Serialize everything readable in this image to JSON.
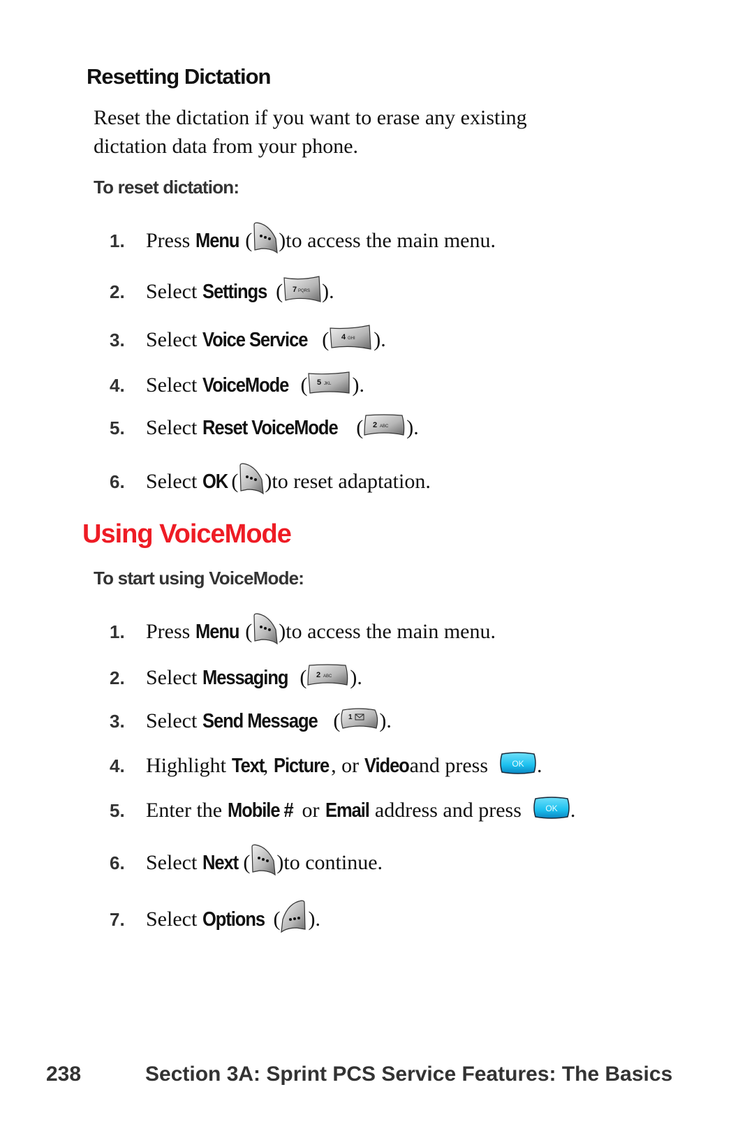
{
  "section1": {
    "heading": "Resetting Dictation",
    "intro_line1": "Reset the dictation if you want to erase any existing",
    "intro_line2": "dictation data from your phone.",
    "subheading": "To reset dictation:",
    "steps": [
      {
        "num": "1.",
        "pre": "Press ",
        "kw": "Menu",
        "icon": "left-softkey-icon",
        "post": " to access the main menu."
      },
      {
        "num": "2.",
        "pre": "Select ",
        "kw": "Settings",
        "icon": "key-7-pqrs-icon",
        "key_label": "7",
        "key_sub": "PQRS",
        "post": "."
      },
      {
        "num": "3.",
        "pre": "Select ",
        "kw": "Voice Service",
        "icon": "key-4-ghi-icon",
        "key_label": "4",
        "key_sub": "GHI",
        "post": "."
      },
      {
        "num": "4.",
        "pre": "Select ",
        "kw": "VoiceMode",
        "icon": "key-5-jkl-icon",
        "key_label": "5",
        "key_sub": "JKL",
        "post": "."
      },
      {
        "num": "5.",
        "pre": "Select ",
        "kw": "Reset VoiceMode",
        "icon": "key-2-abc-icon",
        "key_label": "2",
        "key_sub": "ABC",
        "post": "."
      },
      {
        "num": "6.",
        "pre": "Select ",
        "kw": "OK",
        "icon": "left-softkey-icon",
        "post": " to reset adaptation."
      }
    ]
  },
  "section2": {
    "heading": "Using VoiceMode",
    "subheading": "To start using VoiceMode:",
    "steps": [
      {
        "num": "1.",
        "pre": "Press ",
        "kw": "Menu",
        "icon": "left-softkey-icon",
        "post": " to access the main menu."
      },
      {
        "num": "2.",
        "pre": "Select ",
        "kw": "Messaging",
        "icon": "key-2-abc-icon",
        "key_label": "2",
        "key_sub": "ABC",
        "post": "."
      },
      {
        "num": "3.",
        "pre": "Select ",
        "kw": "Send Message",
        "icon": "key-1-envelope-icon",
        "key_label": "1",
        "key_sub": "✉",
        "post": "."
      },
      {
        "num": "4.",
        "t1": "Highlight ",
        "k1": "Text",
        "t2": ", ",
        "k2": "Picture",
        "t3": ", or ",
        "k3": "Video",
        "t4": " and press ",
        "ok_label": "OK",
        "t5": "."
      },
      {
        "num": "5.",
        "t1": "Enter the ",
        "k1": "Mobile #",
        "t2": " or ",
        "k2": "Email",
        "t3": " address and press ",
        "ok_label": "OK",
        "t4": "."
      },
      {
        "num": "6.",
        "pre": "Select ",
        "kw": "Next",
        "icon": "left-softkey-icon",
        "post": " to continue."
      },
      {
        "num": "7.",
        "pre": "Select ",
        "kw": "Options",
        "icon": "right-softkey-icon",
        "post": "."
      }
    ]
  },
  "footer": {
    "page_number": "238",
    "section_title": "Section 3A: Sprint PCS Service Features: The Basics"
  },
  "colors": {
    "heading_red": "#ee1c25",
    "ok_key_blue": "#1fc3ee"
  },
  "punct": {
    "open": "(",
    "close": ")"
  }
}
